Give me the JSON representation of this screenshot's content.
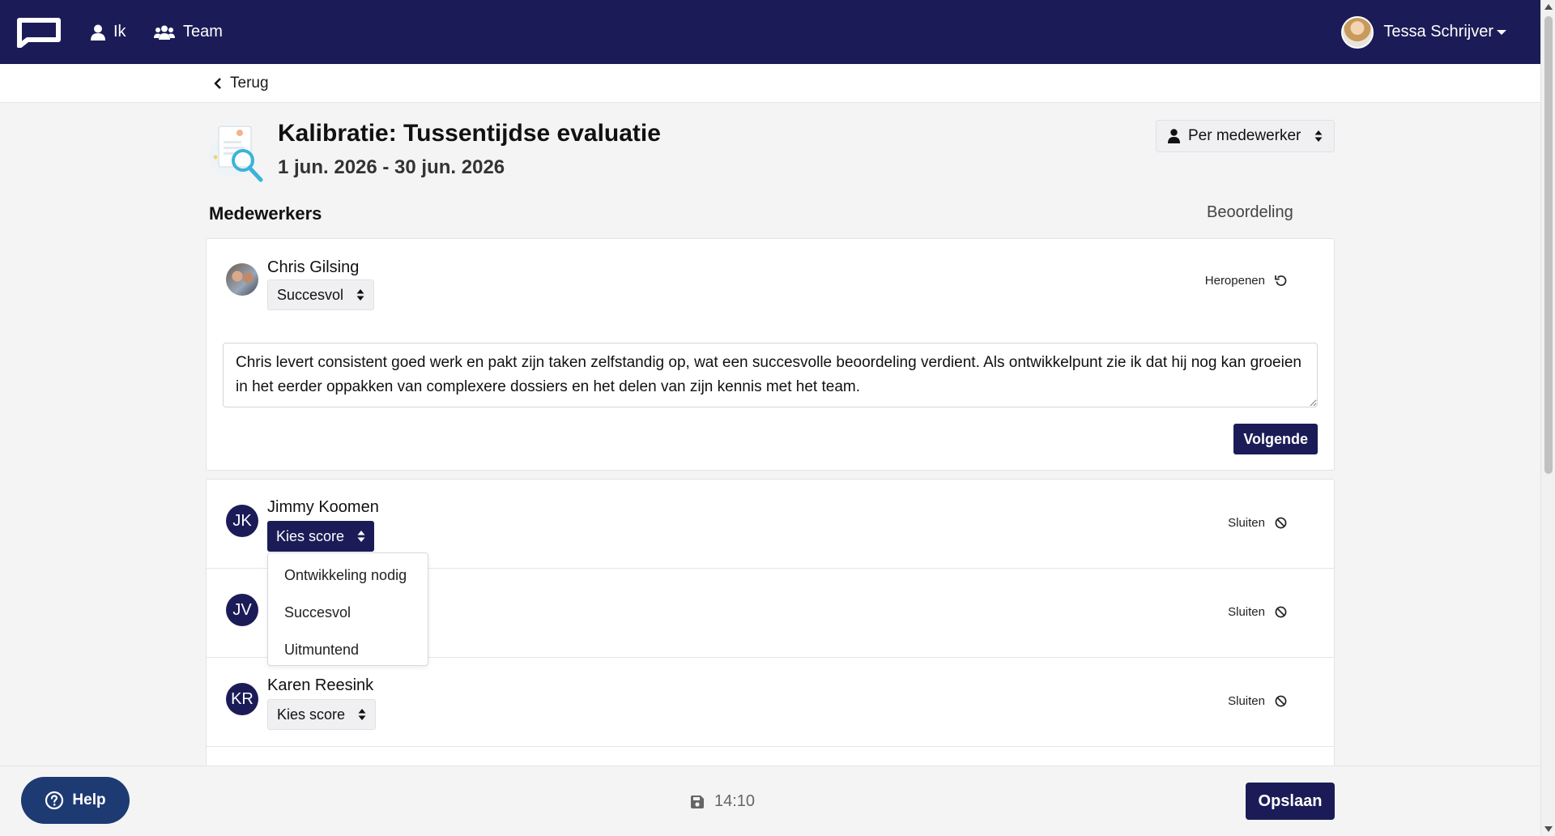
{
  "nav": {
    "items": [
      {
        "label": "Ik",
        "icon": "user-icon"
      },
      {
        "label": "Team",
        "icon": "users-icon"
      }
    ],
    "user_name": "Tessa Schrijver"
  },
  "back": {
    "label": "Terug"
  },
  "header": {
    "title": "Kalibratie: Tussentijdse evaluatie",
    "dates": "1 jun. 2026 - 30 jun. 2026",
    "view_select": "Per medewerker"
  },
  "section": {
    "title": "Medewerkers",
    "column": "Beoordeling"
  },
  "expanded": {
    "name": "Chris Gilsing",
    "score": "Succesvol",
    "action": "Heropenen",
    "comment": "Chris levert consistent goed werk en pakt zijn taken zelfstandig op, wat een succesvolle beoordeling verdient. Als ontwikkelpunt zie ik dat hij nog kan groeien in het eerder oppakken van complexere dossiers en het delen van zijn kennis met het team.",
    "next_label": "Volgende"
  },
  "rows": [
    {
      "initials": "JK",
      "name": "Jimmy Koomen",
      "score": "Kies score",
      "action": "Sluiten"
    },
    {
      "initials": "JV",
      "name": "",
      "score": "",
      "action": "Sluiten"
    },
    {
      "initials": "KR",
      "name": "Karen Reesink",
      "score": "Kies score",
      "action": "Sluiten"
    }
  ],
  "dropdown": {
    "options": [
      "Ontwikkeling nodig",
      "Succesvol",
      "Uitmuntend"
    ]
  },
  "footer": {
    "help_label": "Help",
    "saved_time": "14:10",
    "save_label": "Opslaan"
  },
  "colors": {
    "brand": "#1b1c57",
    "help": "#1e3a73",
    "background": "#f4f4f5"
  }
}
